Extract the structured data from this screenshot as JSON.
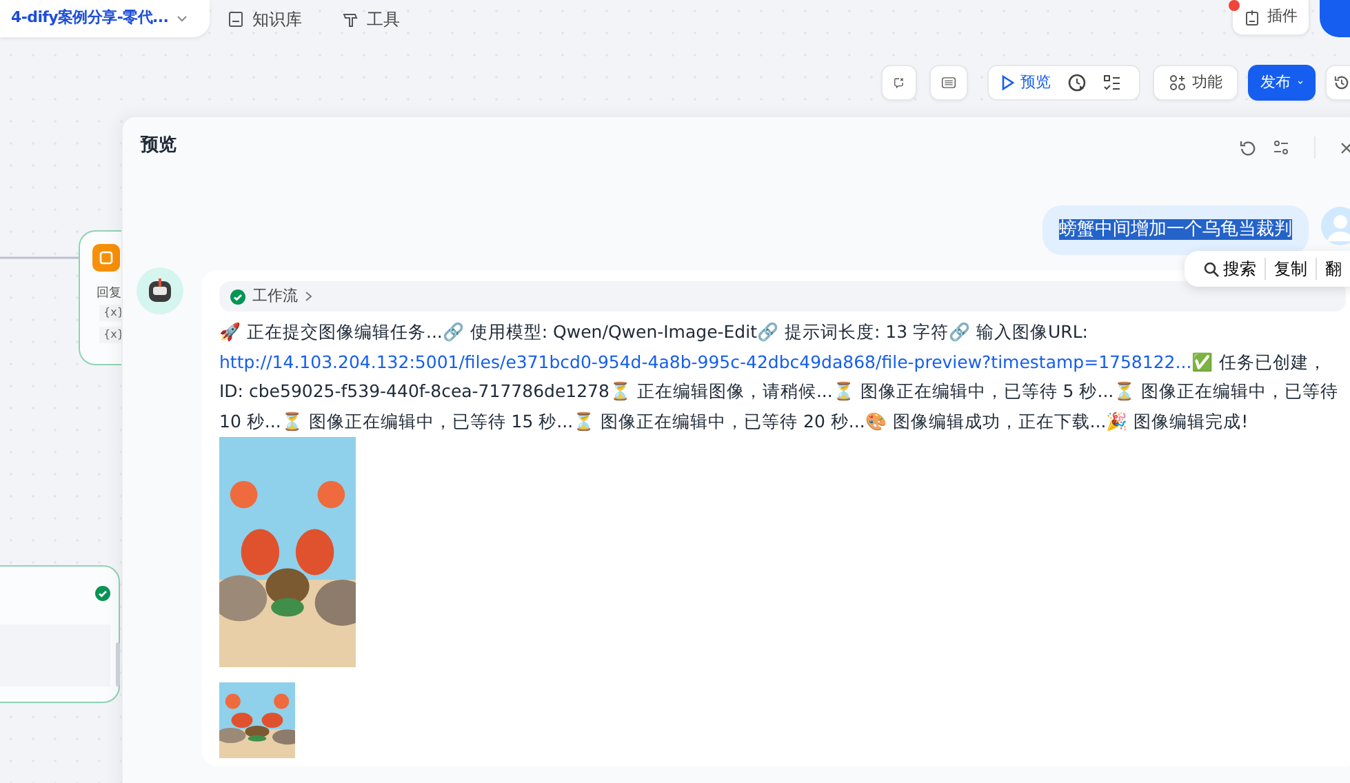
{
  "app": {
    "name": "4-dify案例分享-零代...",
    "nav": [
      {
        "label": "知识库",
        "kind": "knowledge"
      },
      {
        "label": "工具",
        "kind": "tools"
      }
    ],
    "plugins": {
      "label": "插件",
      "notification": true
    }
  },
  "toolbar": {
    "preview": "预览",
    "features": "功能",
    "publish": "发布"
  },
  "canvas": {
    "nodes": [
      {
        "kind": "reply",
        "label": "回复",
        "variables": [
          "{x}",
          "{x}"
        ]
      },
      {
        "kind": "status",
        "done": true
      }
    ]
  },
  "preview": {
    "title": "预览",
    "user_message": {
      "text": "螃蟹中间增加一个乌龟当裁判",
      "selected": true
    },
    "selection_menu": [
      "搜索",
      "复制",
      "翻"
    ],
    "answer": {
      "workflow": {
        "label": "工作流",
        "succeeded": true
      },
      "content": [
        {
          "kind": "text",
          "text": "🚀 正在提交图像编辑任务...🔗 使用模型: Qwen/Qwen-Image-Edit🔗 提示词长度: 13 字符🔗 输入图像URL: "
        },
        {
          "kind": "link",
          "text": "http://14.103.204.132:5001/files/e371bcd0-954d-4a8b-995c-42dbc49da868/file-preview?timestamp=1758122..."
        },
        {
          "kind": "text",
          "text": "✅ 任务已创建，ID: cbe59025-f539-440f-8cea-717786de1278⏳ 正在编辑图像，请稍候...⏳ 图像正在编辑中，已等待 5 秒...⏳ 图像正在编辑中，已等待 10 秒...⏳ 图像正在编辑中，已等待 15 秒...⏳ 图像正在编辑中，已等待 20 秒...🎨 图像编辑成功，正在下载...🎉 图像编辑完成!"
        }
      ]
    }
  }
}
